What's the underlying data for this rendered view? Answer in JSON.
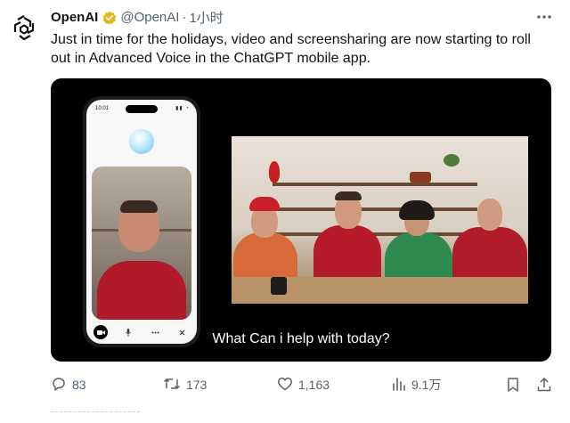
{
  "tweet": {
    "author_name": "OpenAI",
    "handle": "@OpenAI",
    "separator": "·",
    "time": "1小时",
    "text": "Just in time for the holidays, video and screensharing are now starting to roll out in Advanced Voice in the ChatGPT mobile app."
  },
  "media": {
    "caption": "What Can i help with today?",
    "phone": {
      "status_time": "10:01"
    }
  },
  "actions": {
    "replies": "83",
    "reposts": "173",
    "likes": "1,163",
    "views": "9.1万"
  },
  "icons": {
    "avatar": "openai-logo-icon",
    "verified": "verified-badge-icon",
    "more": "more-icon",
    "reply": "reply-icon",
    "repost": "repost-icon",
    "like": "like-icon",
    "views": "views-icon",
    "bookmark": "bookmark-icon",
    "share": "share-icon"
  },
  "colors": {
    "text": "#0f1419",
    "secondary": "#536471",
    "verified": "#e2b719",
    "media_bg": "#000000"
  }
}
